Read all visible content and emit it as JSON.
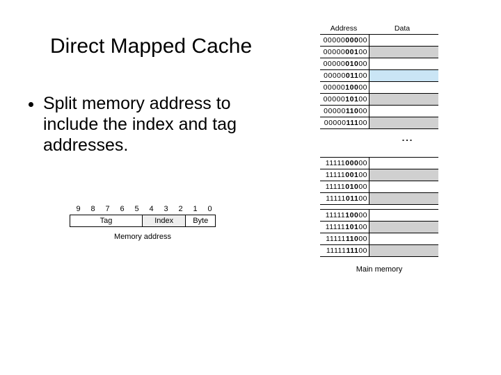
{
  "title": "Direct Mapped Cache",
  "bullet": "Split memory address to include the index and tag addresses.",
  "addr_layout": {
    "bits": [
      "9",
      "8",
      "7",
      "6",
      "5",
      "4",
      "3",
      "2",
      "1",
      "0"
    ],
    "fields": {
      "tag": "Tag",
      "index": "Index",
      "byte": "Byte"
    },
    "caption": "Memory address"
  },
  "memory": {
    "header_addr": "Address",
    "header_data": "Data",
    "caption": "Main memory",
    "dots": "⋮",
    "block1": [
      {
        "tag": "00000",
        "idx": "000",
        "byte": "00",
        "shade": ""
      },
      {
        "tag": "00000",
        "idx": "001",
        "byte": "00",
        "shade": "shade"
      },
      {
        "tag": "00000",
        "idx": "010",
        "byte": "00",
        "shade": ""
      },
      {
        "tag": "00000",
        "idx": "011",
        "byte": "00",
        "shade": "blue"
      },
      {
        "tag": "00000",
        "idx": "100",
        "byte": "00",
        "shade": ""
      },
      {
        "tag": "00000",
        "idx": "101",
        "byte": "00",
        "shade": "shade"
      },
      {
        "tag": "00000",
        "idx": "110",
        "byte": "00",
        "shade": ""
      },
      {
        "tag": "00000",
        "idx": "111",
        "byte": "00",
        "shade": "shade"
      }
    ],
    "block2": [
      {
        "tag": "11111",
        "idx": "000",
        "byte": "00",
        "shade": ""
      },
      {
        "tag": "11111",
        "idx": "001",
        "byte": "00",
        "shade": "shade"
      },
      {
        "tag": "11111",
        "idx": "010",
        "byte": "00",
        "shade": ""
      },
      {
        "tag": "11111",
        "idx": "011",
        "byte": "00",
        "shade": "shade"
      },
      {
        "tag": "11111",
        "idx": "100",
        "byte": "00",
        "shade": ""
      },
      {
        "tag": "11111",
        "idx": "101",
        "byte": "00",
        "shade": "shade"
      },
      {
        "tag": "11111",
        "idx": "110",
        "byte": "00",
        "shade": ""
      },
      {
        "tag": "11111",
        "idx": "111",
        "byte": "00",
        "shade": "shade"
      }
    ]
  }
}
